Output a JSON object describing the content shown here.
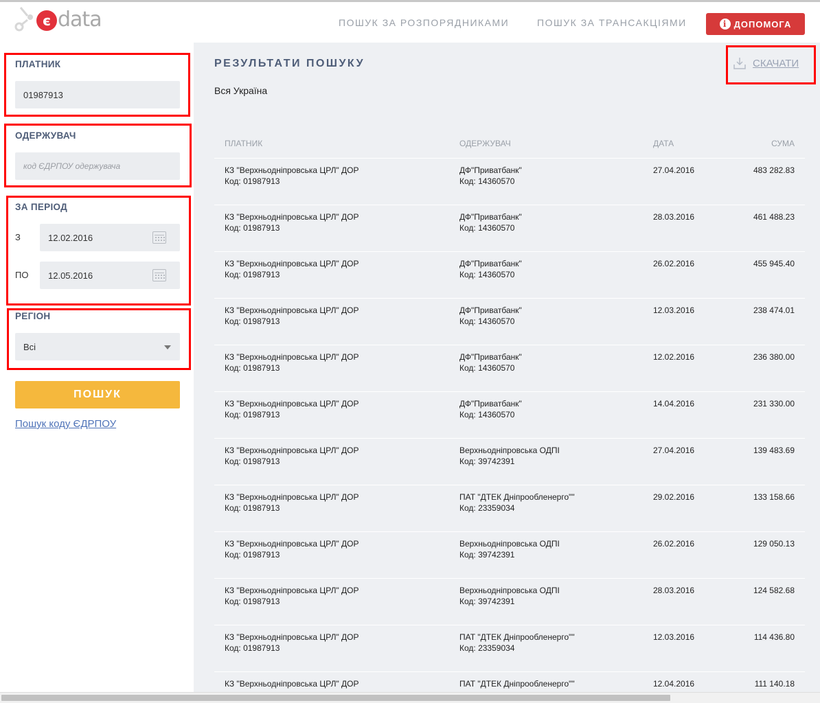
{
  "header": {
    "logo_text": "data",
    "logo_mark": "є",
    "nav": [
      {
        "label": "ПОШУК ЗА РОЗПОРЯДНИКАМИ"
      },
      {
        "label": "ПОШУК ЗА ТРАНСАКЦІЯМИ"
      }
    ],
    "help_label": "ДОПОМОГА",
    "help_icon": "info-icon",
    "accent_color": "#d63a3a"
  },
  "sidebar": {
    "payer": {
      "label": "ПЛАТНИК",
      "value": "01987913"
    },
    "recipient": {
      "label": "ОДЕРЖУВАЧ",
      "value": "",
      "placeholder": "код ЄДРПОУ одержувача"
    },
    "period": {
      "label": "ЗА ПЕРІОД",
      "from_label": "З",
      "from_value": "12.02.2016",
      "to_label": "ПО",
      "to_value": "12.05.2016"
    },
    "region": {
      "label": "РЕГІОН",
      "value": "Всі"
    },
    "search_button": "ПОШУК",
    "edrpou_link": "Пошук коду ЄДРПОУ",
    "button_color": "#f5b83d"
  },
  "main": {
    "title": "РЕЗУЛЬТАТИ ПОШУКУ",
    "region_text": "Вся Україна",
    "download_label": "СКАЧАТИ",
    "columns": {
      "payer": "ПЛАТНИК",
      "recipient": "ОДЕРЖУВАЧ",
      "date": "ДАТА",
      "sum": "СУМА"
    },
    "rows": [
      {
        "payer": "КЗ \"Верхньодніпровська ЦРЛ\" ДОР",
        "payer_code": "Код: 01987913",
        "recipient": "ДФ\"Приватбанк\"",
        "recipient_code": "Код: 14360570",
        "date": "27.04.2016",
        "sum": "483 282.83"
      },
      {
        "payer": "КЗ \"Верхньодніпровська ЦРЛ\" ДОР",
        "payer_code": "Код: 01987913",
        "recipient": "ДФ\"Приватбанк\"",
        "recipient_code": "Код: 14360570",
        "date": "28.03.2016",
        "sum": "461 488.23"
      },
      {
        "payer": "КЗ \"Верхньодніпровська ЦРЛ\" ДОР",
        "payer_code": "Код: 01987913",
        "recipient": "ДФ\"Приватбанк\"",
        "recipient_code": "Код: 14360570",
        "date": "26.02.2016",
        "sum": "455 945.40"
      },
      {
        "payer": "КЗ \"Верхньодніпровська ЦРЛ\" ДОР",
        "payer_code": "Код: 01987913",
        "recipient": "ДФ\"Приватбанк\"",
        "recipient_code": "Код: 14360570",
        "date": "12.03.2016",
        "sum": "238 474.01"
      },
      {
        "payer": "КЗ \"Верхньодніпровська ЦРЛ\" ДОР",
        "payer_code": "Код: 01987913",
        "recipient": "ДФ\"Приватбанк\"",
        "recipient_code": "Код: 14360570",
        "date": "12.02.2016",
        "sum": "236 380.00"
      },
      {
        "payer": "КЗ \"Верхньодніпровська ЦРЛ\" ДОР",
        "payer_code": "Код: 01987913",
        "recipient": "ДФ\"Приватбанк\"",
        "recipient_code": "Код: 14360570",
        "date": "14.04.2016",
        "sum": "231 330.00"
      },
      {
        "payer": "КЗ \"Верхньодніпровська ЦРЛ\" ДОР",
        "payer_code": "Код: 01987913",
        "recipient": "Верхньодніпровська ОДПІ",
        "recipient_code": "Код: 39742391",
        "date": "27.04.2016",
        "sum": "139 483.69"
      },
      {
        "payer": "КЗ \"Верхньодніпровська ЦРЛ\" ДОР",
        "payer_code": "Код: 01987913",
        "recipient": "ПАТ \"ДТЕК Дніпрообленерго\"\"",
        "recipient_code": "Код: 23359034",
        "date": "29.02.2016",
        "sum": "133 158.66"
      },
      {
        "payer": "КЗ \"Верхньодніпровська ЦРЛ\" ДОР",
        "payer_code": "Код: 01987913",
        "recipient": "Верхньодніпровська ОДПІ",
        "recipient_code": "Код: 39742391",
        "date": "26.02.2016",
        "sum": "129 050.13"
      },
      {
        "payer": "КЗ \"Верхньодніпровська ЦРЛ\" ДОР",
        "payer_code": "Код: 01987913",
        "recipient": "Верхньодніпровська ОДПІ",
        "recipient_code": "Код: 39742391",
        "date": "28.03.2016",
        "sum": "124 582.68"
      },
      {
        "payer": "КЗ \"Верхньодніпровська ЦРЛ\" ДОР",
        "payer_code": "Код: 01987913",
        "recipient": "ПАТ \"ДТЕК Дніпрообленерго\"\"",
        "recipient_code": "Код: 23359034",
        "date": "12.03.2016",
        "sum": "114 436.80"
      },
      {
        "payer": "КЗ \"Верхньодніпровська ЦРЛ\" ДОР",
        "payer_code": "",
        "recipient": "ПАТ \"ДТЕК Дніпрообленерго\"\"",
        "recipient_code": "",
        "date": "12.04.2016",
        "sum": "111 140.18"
      }
    ]
  },
  "annotations": {
    "highlight_color": "#ff0000"
  }
}
